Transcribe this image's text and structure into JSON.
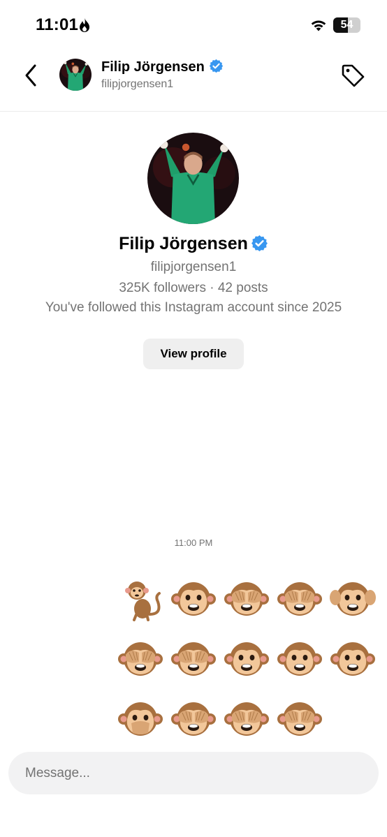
{
  "status_bar": {
    "time": "11:01",
    "battery_level": "54",
    "battery_percent": 54,
    "icons": [
      "flame-icon",
      "wifi-icon",
      "battery-icon"
    ]
  },
  "header": {
    "name": "Filip Jörgensen",
    "username": "filipjorgensen1",
    "icons": [
      "back-chevron-icon",
      "verified-badge-icon",
      "tag-icon"
    ]
  },
  "profile": {
    "name": "Filip Jörgensen",
    "username": "filipjorgensen1",
    "stats": "325K followers · 42 posts",
    "follow_note": "You've followed this Instagram account since 2025",
    "view_profile_label": "View profile"
  },
  "conversation": {
    "timestamp": "11:00 PM",
    "emoji_rows": [
      [
        "🐒",
        "🐵",
        "🙈",
        "🙈",
        "🙉"
      ],
      [
        "🙈",
        "🙈",
        "🐵",
        "🐵",
        "🐵"
      ],
      [
        "🙊",
        "🙈",
        "🙈",
        "🙈"
      ]
    ]
  },
  "composer": {
    "placeholder": "Message..."
  },
  "colors": {
    "verified_blue": "#3897f0",
    "secondary_text": "#737373",
    "button_bg": "#efefef",
    "composer_bg": "#f2f2f3",
    "jersey_green": "#1f9e6a"
  }
}
